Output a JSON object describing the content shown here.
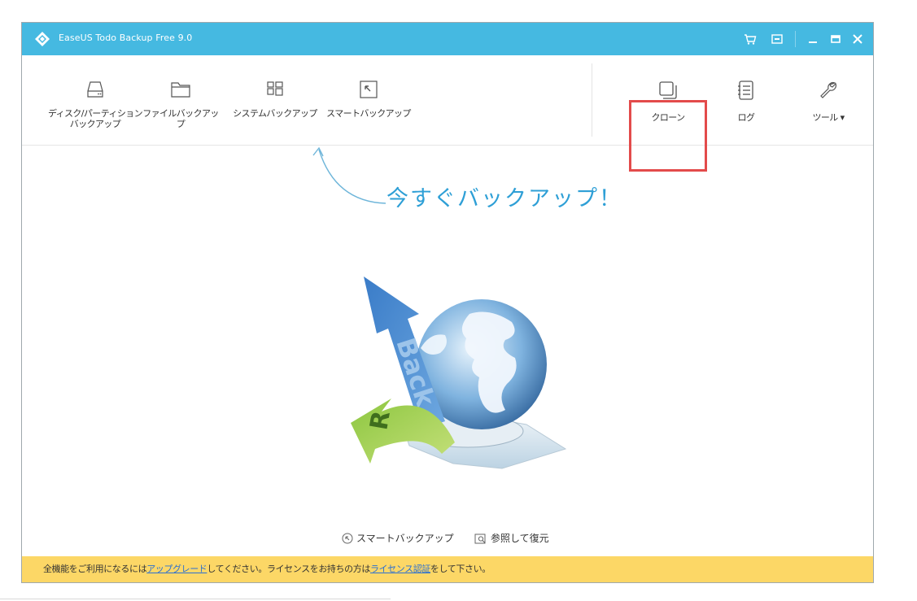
{
  "app": {
    "title": "EaseUS Todo Backup Free 9.0"
  },
  "titlebar": {
    "buttons": [
      {
        "icon": "cart-icon",
        "glyph": "🛒"
      },
      {
        "icon": "menu-box-icon",
        "glyph": "▣"
      },
      {
        "icon": "minimize-icon",
        "glyph": "_"
      },
      {
        "icon": "maximize-icon",
        "glyph": "▬"
      },
      {
        "icon": "close-icon",
        "glyph": "✕"
      }
    ]
  },
  "toolbar": {
    "left_tools": [
      {
        "label": "ディスク/パーティション\nバックアップ",
        "icon": "hard-drive-icon"
      },
      {
        "label": "ファイルバックアップ",
        "icon": "folder-icon"
      },
      {
        "label": "システムバックアップ",
        "icon": "windows-grid-icon"
      },
      {
        "label": "スマートバックアップ",
        "icon": "smart-arrow-icon"
      }
    ],
    "right_tools": [
      {
        "label": "クローン",
        "icon": "clone-icon",
        "highlighted": true
      },
      {
        "label": "ログ",
        "icon": "log-list-icon"
      },
      {
        "label": "ツール ▾",
        "icon": "wrench-icon"
      }
    ]
  },
  "main": {
    "hero_text": "今すぐバックアップ！",
    "illustration_text": "Back  R",
    "links": [
      {
        "label": "スマートバックアップ",
        "icon": "smart-backup-icon"
      },
      {
        "label": "参照して復元",
        "icon": "browse-restore-icon"
      }
    ]
  },
  "statusbar": {
    "text_before": "全機能をご利用になるには",
    "link_upgrade": "アップグレード",
    "text_middle": "してください。ライセンスをお持ちの方は",
    "link_license": "ライセンス認証",
    "text_after": "をして下さい。"
  },
  "colors": {
    "titlebar": "#45b9e1",
    "hero_text": "#2e9fd6",
    "statusbar": "#fcd766",
    "highlight": "#e34b4b",
    "link": "#2a6fd1"
  }
}
